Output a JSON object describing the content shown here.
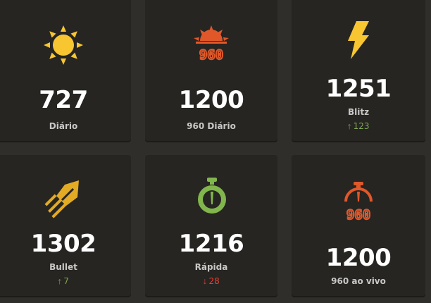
{
  "cards": [
    {
      "rating": "727",
      "label": "Diário",
      "icon": "sun-icon"
    },
    {
      "rating": "1200",
      "label": "960 Diário",
      "icon": "sun-960-icon"
    },
    {
      "rating": "1251",
      "label": "Blitz",
      "icon": "lightning-icon",
      "change": "123",
      "direction": "up"
    },
    {
      "rating": "1302",
      "label": "Bullet",
      "icon": "bullet-icon",
      "change": "7",
      "direction": "up"
    },
    {
      "rating": "1216",
      "label": "Rápida",
      "icon": "stopwatch-icon",
      "change": "28",
      "direction": "down"
    },
    {
      "rating": "1200",
      "label": "960 ao vivo",
      "icon": "stopwatch-960-icon"
    }
  ],
  "colors": {
    "background": "#302e2b",
    "card": "#262522",
    "sun": "#f7c631",
    "orange": "#e0582a",
    "blitz": "#f7c631",
    "bullet": "#e3aa24",
    "rapid": "#81b64c",
    "up": "#7fa650",
    "down": "#e0402f"
  }
}
